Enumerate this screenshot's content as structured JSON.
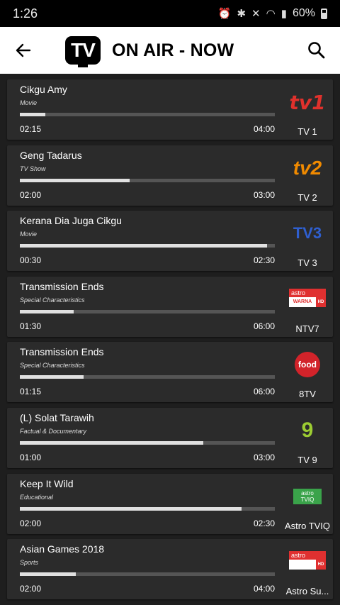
{
  "status": {
    "time": "1:26",
    "battery": "60%"
  },
  "appbar": {
    "title": "ON AIR - NOW",
    "logo_text": "TV"
  },
  "programs": [
    {
      "title": "Cikgu Amy",
      "genre": "Movie",
      "start": "02:15",
      "end": "04:00",
      "progress": 0.1,
      "channel": "TV 1",
      "logo_text": "tv1",
      "logo_type": "tv1"
    },
    {
      "title": "Geng Tadarus",
      "genre": "TV Show",
      "start": "02:00",
      "end": "03:00",
      "progress": 0.43,
      "channel": "TV 2",
      "logo_text": "tv2",
      "logo_type": "tv2"
    },
    {
      "title": "Kerana Dia Juga Cikgu",
      "genre": "Movie",
      "start": "00:30",
      "end": "02:30",
      "progress": 0.97,
      "channel": "TV 3",
      "logo_text": "TV3",
      "logo_type": "tv3"
    },
    {
      "title": "Transmission Ends",
      "genre": "Special Characteristics",
      "start": "01:30",
      "end": "06:00",
      "progress": 0.21,
      "channel": "NTV7",
      "logo_text": "astro",
      "logo_sub": "WARNA",
      "logo_hd": "HD",
      "logo_type": "astro"
    },
    {
      "title": "Transmission Ends",
      "genre": "Special Characteristics",
      "start": "01:15",
      "end": "06:00",
      "progress": 0.25,
      "channel": "8TV",
      "logo_text": "food",
      "logo_type": "food"
    },
    {
      "title": "(L) Solat Tarawih",
      "genre": "Factual & Documentary",
      "start": "01:00",
      "end": "03:00",
      "progress": 0.72,
      "channel": "TV 9",
      "logo_text": "9",
      "logo_type": "tv9"
    },
    {
      "title": "Keep It Wild",
      "genre": "Educational",
      "start": "02:00",
      "end": "02:30",
      "progress": 0.87,
      "channel": "Astro TVIQ",
      "logo_text": "astro",
      "logo_sub": "TVIQ",
      "logo_type": "tviq"
    },
    {
      "title": "Asian Games 2018",
      "genre": "Sports",
      "start": "02:00",
      "end": "04:00",
      "progress": 0.22,
      "channel": "Astro Su...",
      "logo_text": "astro",
      "logo_sub": "",
      "logo_hd": "HD",
      "logo_type": "astro"
    }
  ],
  "colors": {
    "card": "#2b2b2b",
    "background": "#1e1e1e",
    "bar_track": "#555555",
    "bar_fill": "#e0e0e0"
  }
}
